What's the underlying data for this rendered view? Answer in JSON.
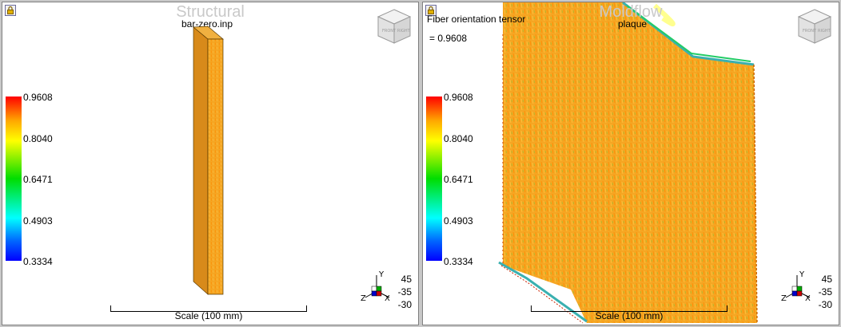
{
  "left_view": {
    "title": "Structural",
    "file": "bar-zero.inp",
    "legend": [
      "0.9608",
      "0.8040",
      "0.6471",
      "0.4903",
      "0.3334"
    ],
    "scale_label": "Scale (100 mm)",
    "angles": [
      "45",
      "-35",
      "-30"
    ],
    "axis_labels": {
      "y": "Y",
      "x": "X",
      "z": "Z"
    }
  },
  "right_view": {
    "title": "Moldflow",
    "result_name": "Fiber orientation tensor",
    "result_value": "= 0.9608",
    "file": "plaque",
    "legend": [
      "0.9608",
      "0.8040",
      "0.6471",
      "0.4903",
      "0.3334"
    ],
    "scale_label": "Scale (100 mm)",
    "angles": [
      "45",
      "-35",
      "-30"
    ],
    "axis_labels": {
      "y": "Y",
      "x": "X",
      "z": "Z"
    }
  },
  "colors": {
    "high": "#ff0000",
    "mid": "#ffff00",
    "low": "#0000ff",
    "model_fill": "#f5a623"
  },
  "icons": [
    "lock-icon",
    "view-cube-icon",
    "axis-triad-icon"
  ]
}
